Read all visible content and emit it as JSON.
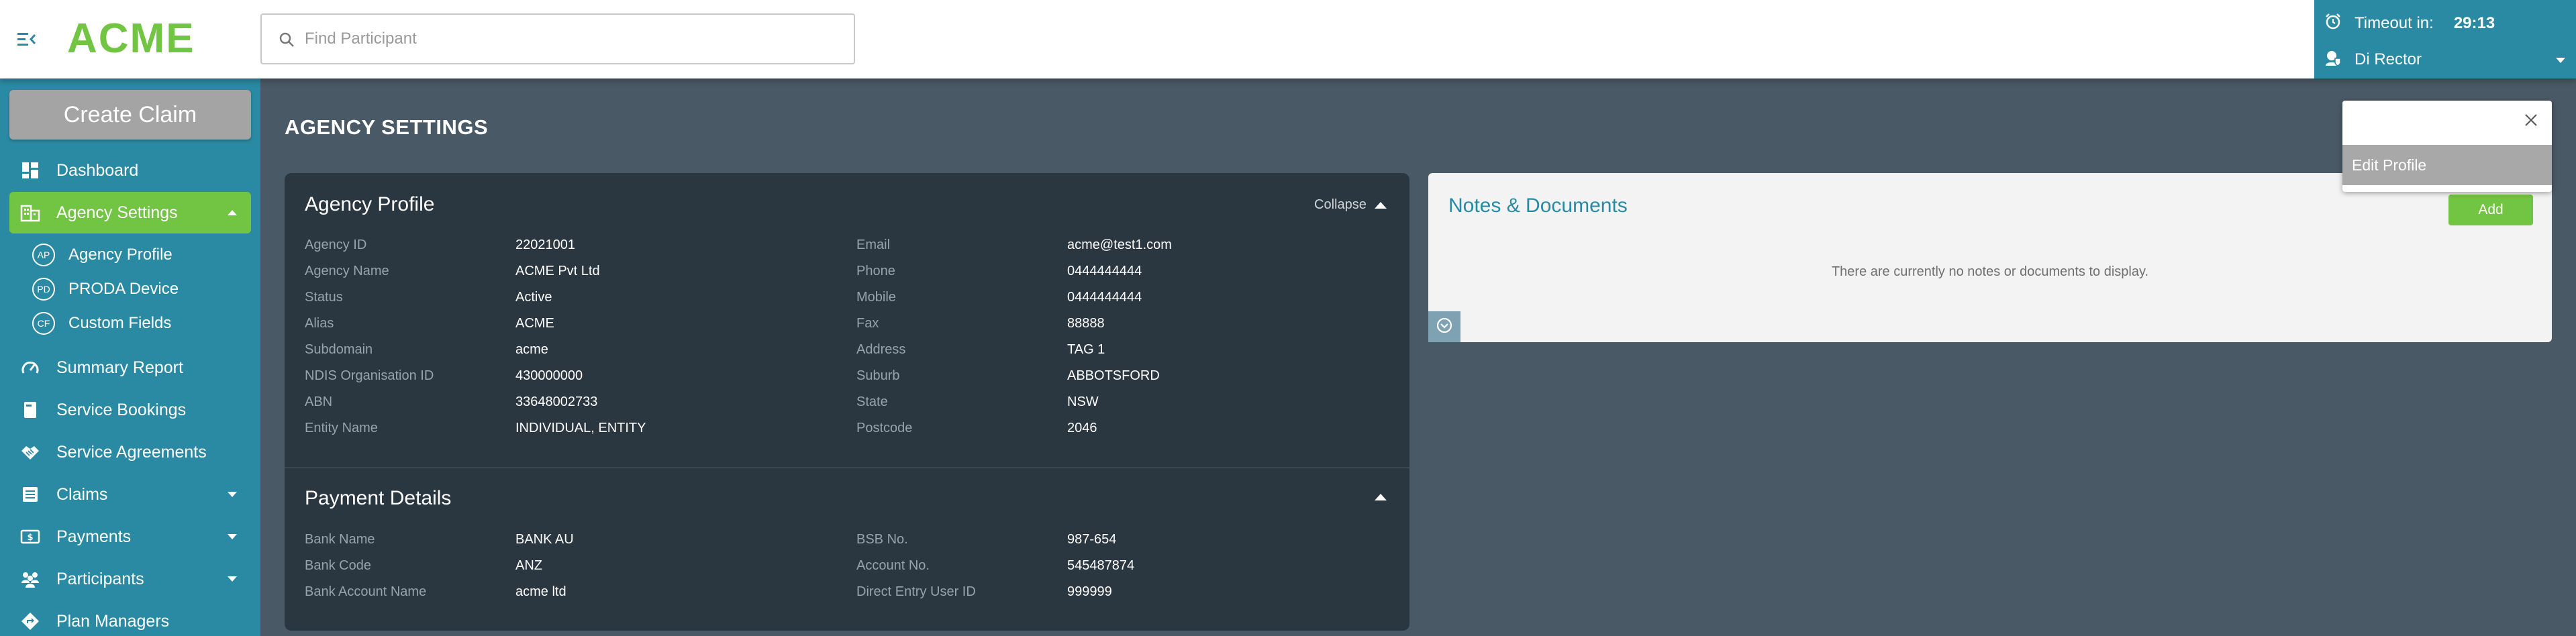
{
  "header": {
    "logo": "ACME",
    "search_placeholder": "Find Participant",
    "timeout_label": "Timeout in:",
    "timeout_value": "29:13",
    "user_name": "Di Rector"
  },
  "sidebar": {
    "create_claim": "Create Claim",
    "items": [
      {
        "label": "Dashboard"
      },
      {
        "label": "Agency Settings"
      },
      {
        "label": "Summary Report"
      },
      {
        "label": "Service Bookings"
      },
      {
        "label": "Service Agreements"
      },
      {
        "label": "Claims"
      },
      {
        "label": "Payments"
      },
      {
        "label": "Participants"
      },
      {
        "label": "Plan Managers"
      }
    ],
    "sub_items": [
      {
        "badge": "AP",
        "label": "Agency Profile"
      },
      {
        "badge": "PD",
        "label": "PRODA Device"
      },
      {
        "badge": "CF",
        "label": "Custom Fields"
      }
    ]
  },
  "page": {
    "title": "AGENCY SETTINGS"
  },
  "agency_profile": {
    "title": "Agency Profile",
    "collapse_label": "Collapse",
    "left": [
      {
        "k": "Agency ID",
        "v": "22021001"
      },
      {
        "k": "Agency Name",
        "v": "ACME Pvt Ltd"
      },
      {
        "k": "Status",
        "v": "Active"
      },
      {
        "k": "Alias",
        "v": "ACME"
      },
      {
        "k": "Subdomain",
        "v": "acme"
      },
      {
        "k": "NDIS Organisation ID",
        "v": "430000000"
      },
      {
        "k": "ABN",
        "v": "33648002733"
      },
      {
        "k": "Entity Name",
        "v": "INDIVIDUAL, ENTITY"
      }
    ],
    "right": [
      {
        "k": "Email",
        "v": "acme@test1.com"
      },
      {
        "k": "Phone",
        "v": "0444444444"
      },
      {
        "k": "Mobile",
        "v": "0444444444"
      },
      {
        "k": "Fax",
        "v": "88888"
      },
      {
        "k": "Address",
        "v": "TAG 1"
      },
      {
        "k": "Suburb",
        "v": "ABBOTSFORD"
      },
      {
        "k": "State",
        "v": "NSW"
      },
      {
        "k": "Postcode",
        "v": "2046"
      }
    ]
  },
  "payment_details": {
    "title": "Payment Details",
    "left": [
      {
        "k": "Bank Name",
        "v": "BANK AU"
      },
      {
        "k": "Bank Code",
        "v": "ANZ"
      },
      {
        "k": "Bank Account Name",
        "v": "acme ltd"
      }
    ],
    "right": [
      {
        "k": "BSB No.",
        "v": "987-654"
      },
      {
        "k": "Account No.",
        "v": "545487874"
      },
      {
        "k": "Direct Entry User ID",
        "v": "999999"
      }
    ]
  },
  "notes": {
    "title": "Notes & Documents",
    "add_label": "Add",
    "empty_text": "There are currently no notes or documents to display."
  },
  "popup": {
    "item": "Edit Profile"
  },
  "colors": {
    "brand_green": "#72c443",
    "teal": "#2a8aa3",
    "card_dark": "#2a3640",
    "page_bg": "#4a5966"
  }
}
